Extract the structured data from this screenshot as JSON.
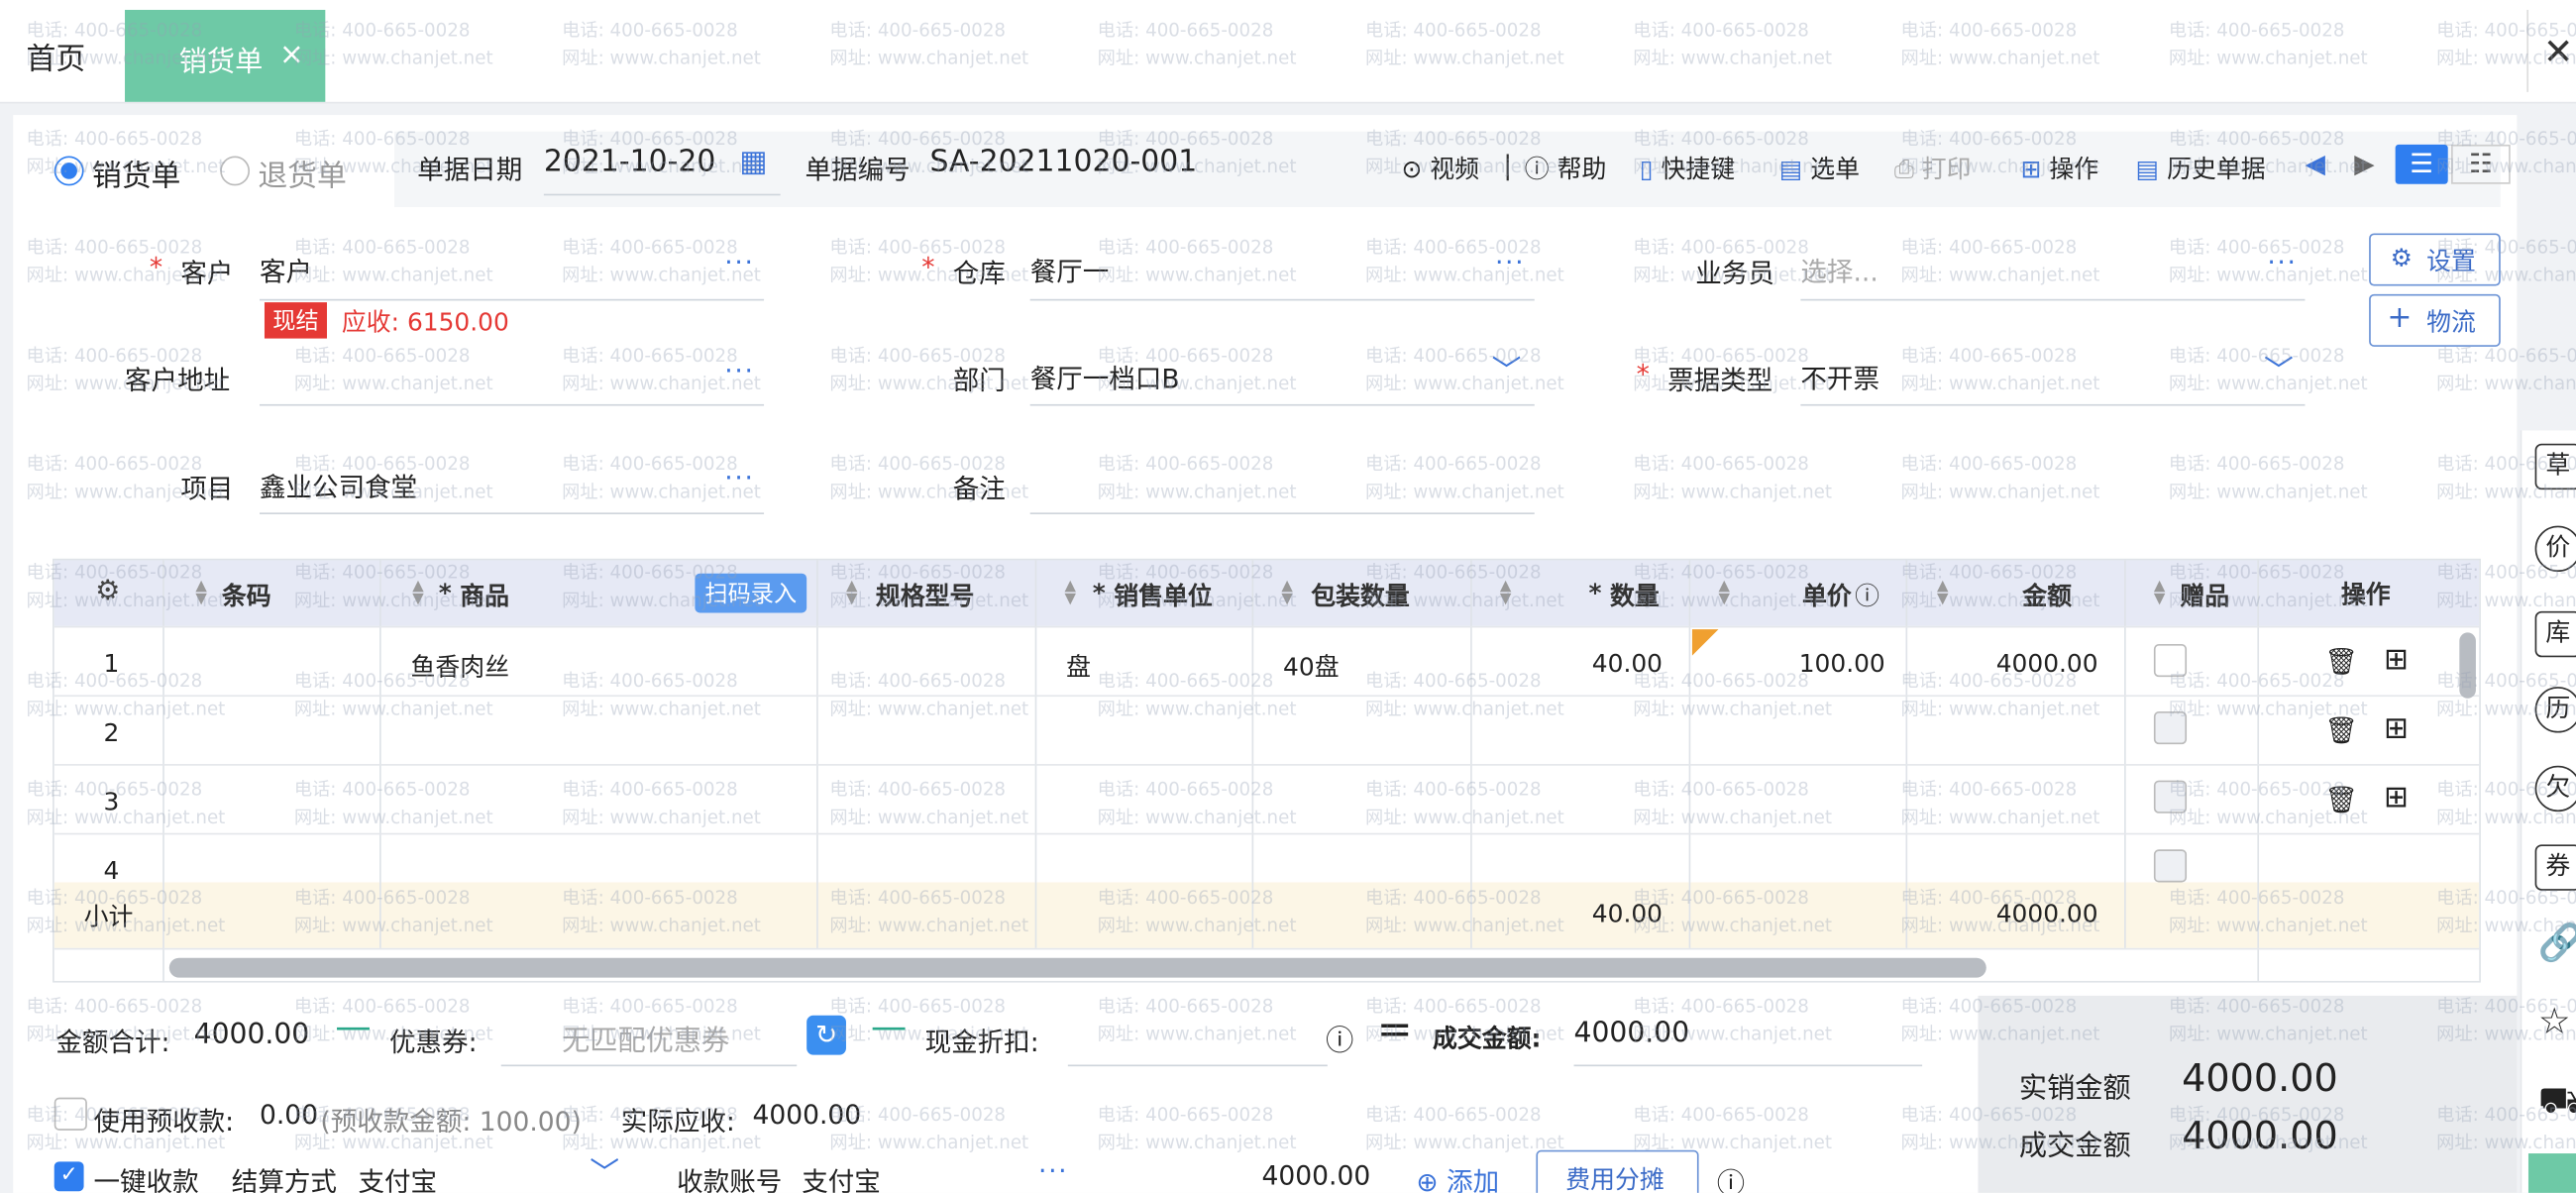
{
  "tabs": {
    "home": "首页",
    "active": "销货单"
  },
  "doc_type": {
    "sale": "销货单",
    "return": "退货单"
  },
  "header": {
    "date_label": "单据日期",
    "date_value": "2021-10-20",
    "no_label": "单据编号",
    "no_value": "SA-20211020-001",
    "toolbar": {
      "video": "视频",
      "help": "帮助",
      "shortcut": "快捷键",
      "select": "选单",
      "print": "打印",
      "operate": "操作",
      "history": "历史单据"
    }
  },
  "form": {
    "customer_label": "客户",
    "customer_value": "客户",
    "warehouse_label": "仓库",
    "warehouse_value": "餐厅一",
    "salesman_label": "业务员",
    "salesman_placeholder": "选择...",
    "settings_btn": "设置",
    "logistics_btn": "物流",
    "settle_tag": "现结",
    "receivable": "应收: 6150.00",
    "address_label": "客户地址",
    "dept_label": "部门",
    "dept_value": "餐厅一档口B",
    "invoice_label": "票据类型",
    "invoice_value": "不开票",
    "project_label": "项目",
    "project_value": "鑫业公司食堂",
    "remark_label": "备注"
  },
  "table": {
    "headers": {
      "barcode": "条码",
      "goods": "商品",
      "scan": "扫码录入",
      "spec": "规格型号",
      "unit": "销售单位",
      "pack_qty": "包装数量",
      "qty": "数量",
      "price": "单价",
      "amount": "金额",
      "gift": "赠品",
      "ops": "操作"
    },
    "rows": [
      {
        "no": "1",
        "goods": "鱼香肉丝",
        "unit": "盘",
        "pack_qty": "40盘",
        "qty": "40.00",
        "price": "100.00",
        "amount": "4000.00"
      },
      {
        "no": "2"
      },
      {
        "no": "3"
      },
      {
        "no": "4"
      }
    ],
    "subtotal_label": "小计",
    "subtotal_qty": "40.00",
    "subtotal_amount": "4000.00"
  },
  "footer": {
    "total_label": "金额合计:",
    "total_value": "4000.00",
    "coupon_label": "优惠券:",
    "coupon_placeholder": "无匹配优惠券",
    "cash_discount_label": "现金折扣:",
    "deal_label": "成交金额:",
    "deal_value": "4000.00",
    "prepay_label": "使用预收款:",
    "prepay_value": "0.00",
    "prepay_note": "(预收款金额: 100.00)",
    "actual_recv_label": "实际应收:",
    "actual_recv_value": "4000.00",
    "one_click_label": "一键收款",
    "settle_method_label": "结算方式",
    "settle_method_value": "支付宝",
    "account_label": "收款账号",
    "account_value": "支付宝",
    "account_amount": "4000.00",
    "add_label": "添加",
    "fee_split_label": "费用分摊"
  },
  "summary": {
    "actual_sales_label": "实销金额",
    "actual_sales_value": "4000.00",
    "deal_label": "成交金额",
    "deal_value": "4000.00"
  },
  "rail": [
    "草",
    "价",
    "库",
    "历",
    "欠",
    "券"
  ],
  "watermark": {
    "phone": "电话: 400-665-0028",
    "site": "网址: www.chanjet.net"
  },
  "colors": {
    "accent": "#2f7ef0",
    "tab_active": "#6ec9a6",
    "required": "#e53935"
  }
}
